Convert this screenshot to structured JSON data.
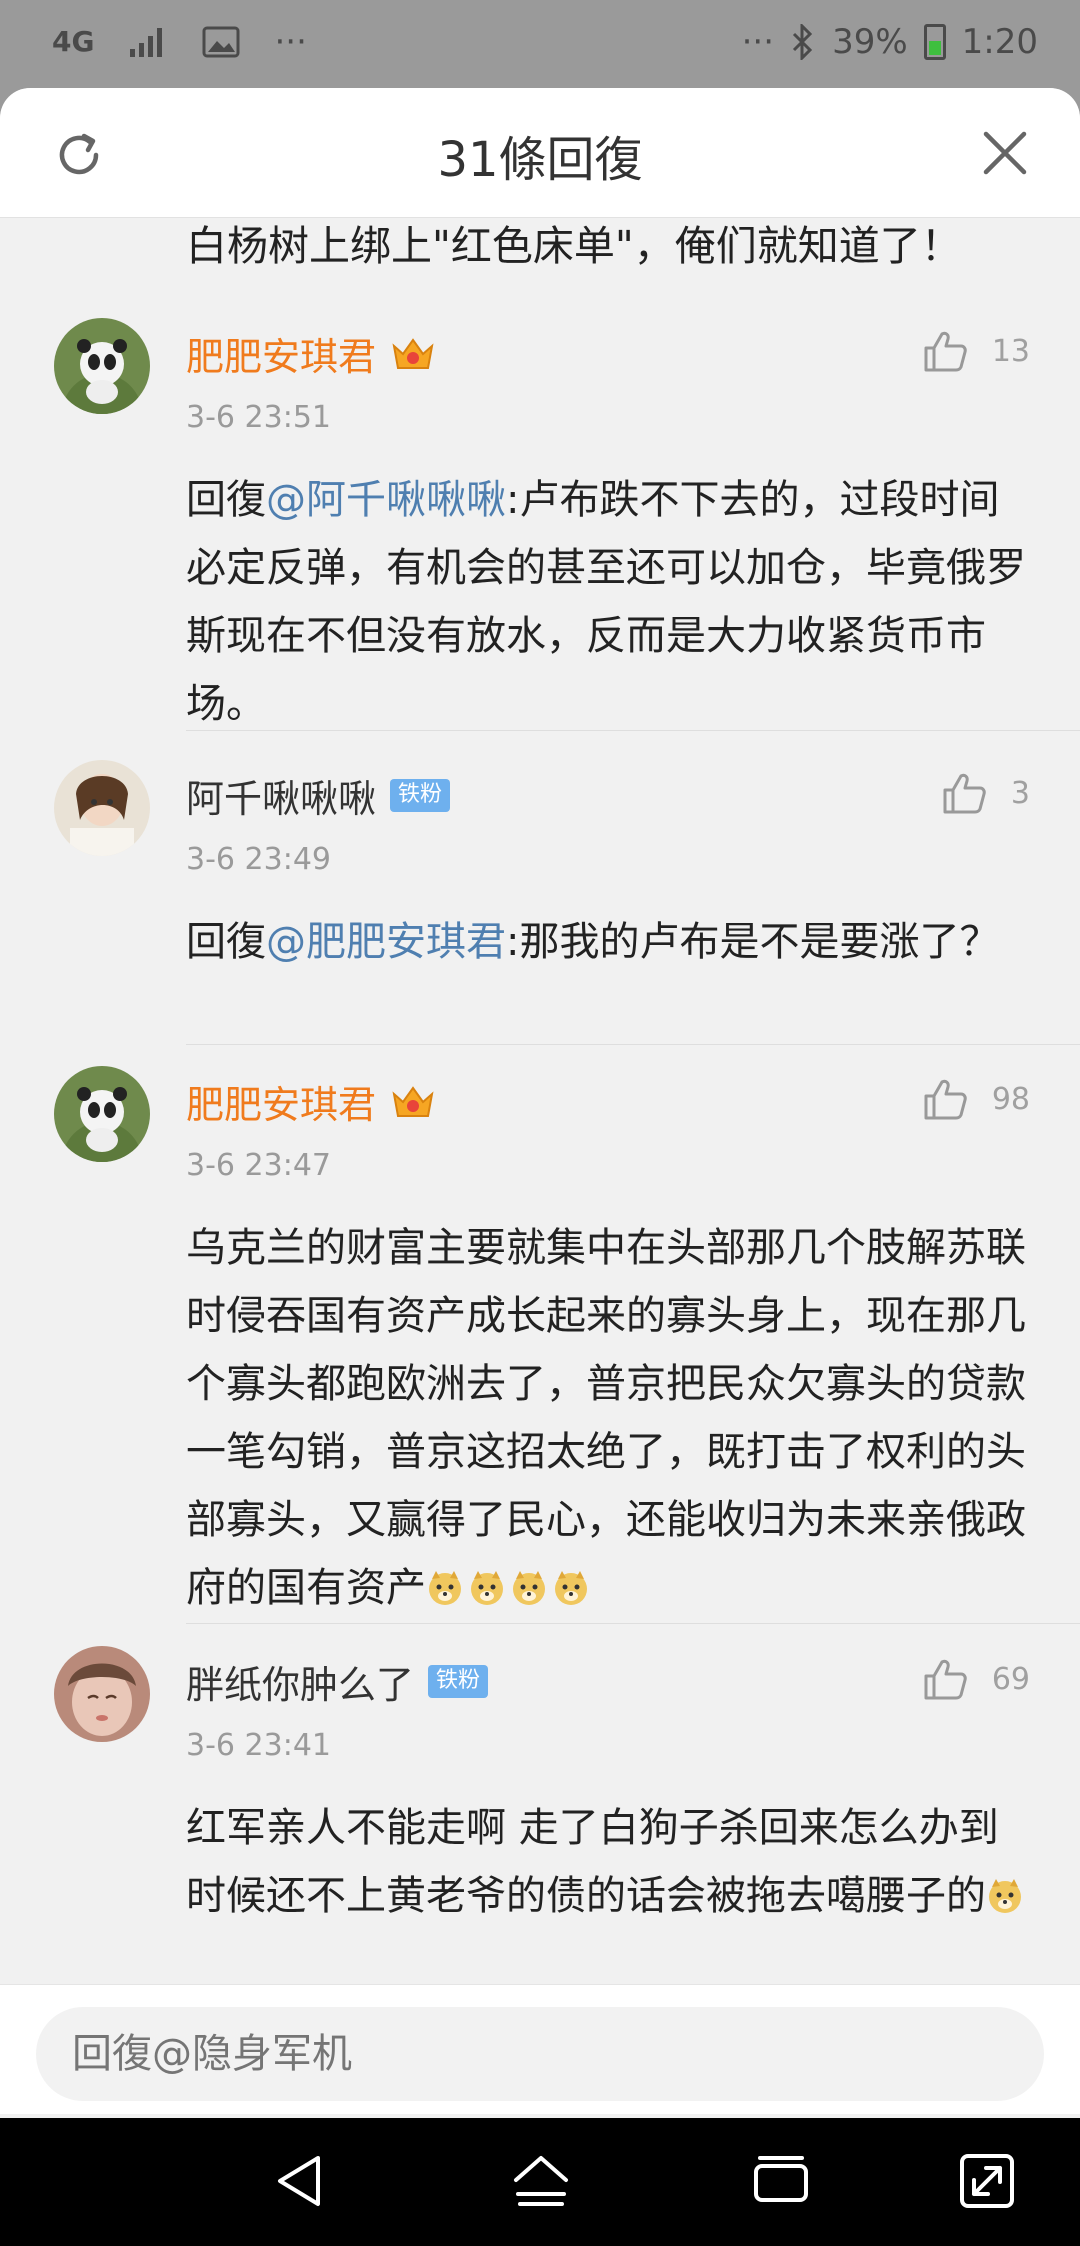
{
  "status_bar": {
    "network": "4G",
    "more": "···",
    "more_right": "···",
    "battery": "39%",
    "time": "1:20"
  },
  "sheet": {
    "title": "31條回復"
  },
  "top_partial_text": "白杨树上绑上\"红色床单\"，俺们就知道了！",
  "comments": [
    {
      "name": "肥肥安琪君",
      "time": "3-6 23:51",
      "likes": "13",
      "reply_prefix": "回復",
      "mention": "@阿千啾啾啾",
      "text": ":卢布跌不下去的，过段时间必定反弹，有机会的甚至还可以加仓，毕竟俄罗斯现在不但没有放水，反而是大力收紧货币市场。"
    },
    {
      "name": "阿千啾啾啾",
      "badge": "铁粉",
      "time": "3-6 23:49",
      "likes": "3",
      "reply_prefix": "回復",
      "mention": "@肥肥安琪君",
      "text": ":那我的卢布是不是要涨了？"
    },
    {
      "name": "肥肥安琪君",
      "time": "3-6 23:47",
      "likes": "98",
      "text": "乌克兰的财富主要就集中在头部那几个肢解苏联时侵吞国有资产成长起来的寡头身上，现在那几个寡头都跑欧洲去了，普京把民众欠寡头的贷款一笔勾销，普京这招太绝了，既打击了权利的头部寡头，又赢得了民心，还能收归为未来亲俄政府的国有资产"
    },
    {
      "name": "胖纸你肿么了",
      "badge": "铁粉",
      "time": "3-6 23:41",
      "likes": "69",
      "text": "红军亲人不能走啊 走了白狗子杀回来怎么办到时候还不上黄老爷的债的话会被拖去噶腰子的"
    }
  ],
  "reply_bar": {
    "placeholder": "回復@隐身军机"
  },
  "colors": {
    "vip_name": "#f07b1d",
    "mention": "#4f7fb0",
    "badge": "#6eb0ee"
  }
}
